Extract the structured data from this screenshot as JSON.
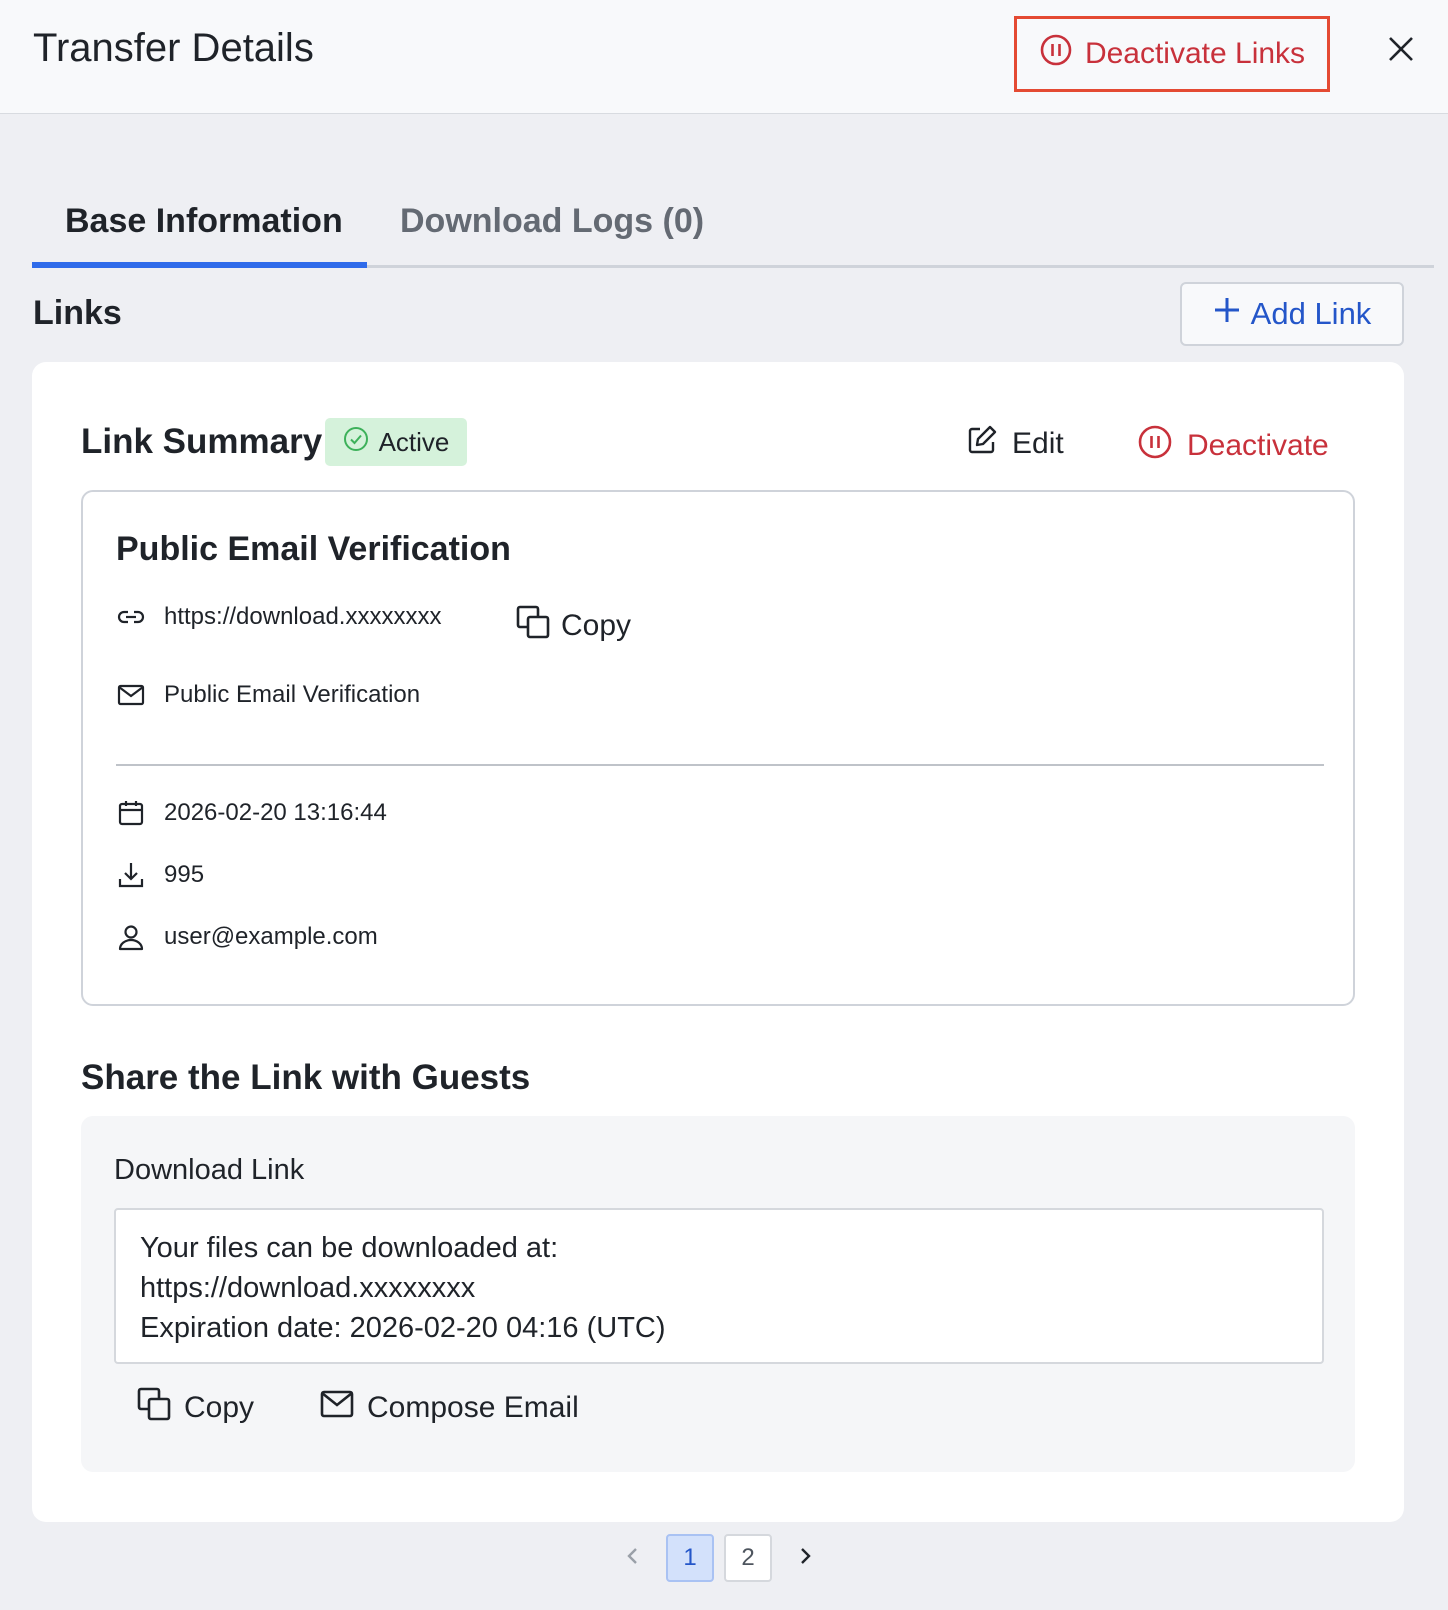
{
  "header": {
    "title": "Transfer Details",
    "deactivate_links_label": "Deactivate Links"
  },
  "tabs": [
    {
      "label": "Base Information",
      "active": true
    },
    {
      "label": "Download Logs (0)",
      "active": false
    }
  ],
  "links_section": {
    "heading": "Links",
    "add_link_label": "Add Link"
  },
  "link_summary": {
    "title": "Link Summary",
    "status": "Active",
    "edit_label": "Edit",
    "deactivate_label": "Deactivate",
    "details": {
      "name": "Public Email Verification",
      "url": "https://download.xxxxxxxx",
      "copy_label": "Copy",
      "auth_method": "Public Email Verification",
      "date": "2026-02-20 13:16:44",
      "downloads": "995",
      "user": "user@example.com"
    }
  },
  "share": {
    "heading": "Share the Link with Guests",
    "label": "Download Link",
    "message_lines": [
      "Your files can be downloaded at:",
      "https://download.xxxxxxxx",
      "Expiration date: 2026-02-20 04:16 (UTC)"
    ],
    "copy_label": "Copy",
    "compose_label": "Compose Email"
  },
  "pagination": {
    "pages": [
      "1",
      "2"
    ],
    "current": "1"
  },
  "colors": {
    "accent_blue": "#2f6bea",
    "danger_red": "#c8313b",
    "highlight_red": "#e44a33",
    "success_bg": "#d5f2db",
    "success_icon": "#3db15a"
  },
  "icons": [
    "pause-circle-icon",
    "close-icon",
    "plus-icon",
    "check-circle-icon",
    "edit-icon",
    "link-icon",
    "copy-icon",
    "mail-icon",
    "calendar-icon",
    "download-icon",
    "user-icon",
    "chevron-left-icon",
    "chevron-right-icon"
  ]
}
